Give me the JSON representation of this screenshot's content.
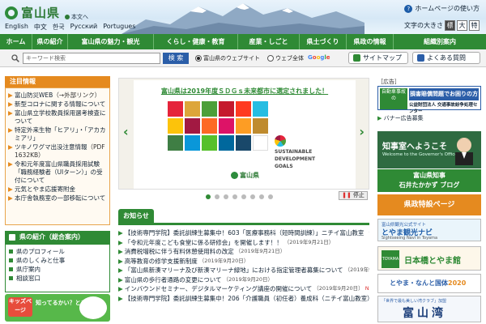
{
  "header": {
    "logo_text": "富山県",
    "skip_link": "本文へ",
    "languages": [
      "English",
      "中文",
      "한국",
      "Русский",
      "Portugues"
    ],
    "howto_link": "ホームページの使い方",
    "fontsize_label": "文字の大きさ",
    "fontsize_options": [
      "標",
      "大",
      "特"
    ]
  },
  "nav": {
    "items": [
      "ホーム",
      "県の紹介",
      "富山県の魅力・観光",
      "くらし・健康・教育",
      "産業・しごと",
      "県土づくり",
      "県政の情報",
      "組織別案内"
    ]
  },
  "search": {
    "placeholder": "キーワード検索",
    "button_label": "検 索",
    "options": [
      "富山県のウェブサイト",
      "ウェブ全体"
    ],
    "google_label": "Google",
    "sitemap_label": "サイトマップ",
    "faq_label": "よくある質問"
  },
  "notices": {
    "heading": "注目情報",
    "items": [
      {
        "text": "富山防災WEB",
        "tag": "（→外部リンク）"
      },
      {
        "text": "新型コロナに関する情報について",
        "tag": ""
      },
      {
        "text": "富山県立学校教員採用選考検査について",
        "tag": ""
      },
      {
        "text": "特定外来生物「ヒアリ」・「アカカミアリ」",
        "tag": ""
      },
      {
        "text": "ツキノワグマ出没注意情報",
        "tag": "（PDF 1632KB）"
      },
      {
        "text": "令和元年度富山県職員採用試験「職務経験者（UIターン）」の受付について",
        "tag": ""
      },
      {
        "text": "元気とやま応援寄附金",
        "tag": ""
      },
      {
        "text": "本庁舎執務室の一部移転について",
        "tag": ""
      }
    ]
  },
  "pref_info": {
    "heading": "県の紹介（総合案内）",
    "items": [
      "県のプロフィール",
      "県のしくみと仕事",
      "県庁案内",
      "相談窓口"
    ]
  },
  "kids": {
    "badge": "キッズページ",
    "text": "知ってるかい？とやまけん"
  },
  "slider": {
    "headline": "富山県は2019年度ＳＤＧｓ未来都市に選定されました！",
    "sdg_colors": [
      "#e5243b",
      "#dda63a",
      "#4c9f38",
      "#c5192d",
      "#ff3a21",
      "#26bde2",
      "#fcc30b",
      "#a21942",
      "#fd6925",
      "#dd1367",
      "#fd9d24",
      "#bf8b2e",
      "#3f7e44",
      "#0a97d9",
      "#56c02b",
      "#00689d",
      "#19486a",
      "#ffffff"
    ],
    "goals_text": "SUSTAINABLE DEVELOPMENT GOALS",
    "logo_text": "富山県",
    "stop_label": "停止",
    "dot_count": 8,
    "active_dot": 0
  },
  "news": {
    "heading": "お知らせ",
    "items": [
      {
        "text": "【技術専門学院】委託訓練生募集中！603「医療事務科（短時間訓練）」ニチイ富山教室",
        "date": "（2019年9月22日）",
        "new": false
      },
      {
        "text": "「令和元年度こども食堂に係る研修会」を開催します！！",
        "date": "（2019年9月21日）",
        "new": false
      },
      {
        "text": "消費税増税に伴う有料休憩使用料の改定",
        "date": "（2019年9月21日）",
        "new": false
      },
      {
        "text": "高等教育の修学支援新制度",
        "date": "（2019年9月20日）",
        "new": false
      },
      {
        "text": "「富山県新湊マリーナ及び新湊マリーナ緑地」における指定管理者募集について",
        "date": "（2019年9月20日）",
        "new": false
      },
      {
        "text": "富山県の歩行者通路の変更について",
        "date": "（2019年9月20日）",
        "new": false
      },
      {
        "text": "インバウンドセミナー、デジタルマーケティング講座の開催について",
        "date": "（2019年9月20日）",
        "new": true
      },
      {
        "text": "【技術専門学院】委託訓練生募集中！206「介護職員（初任者）養成科（ニチイ富山教室）」",
        "date": "",
        "new": false
      }
    ]
  },
  "right": {
    "ad_label": "［広告］",
    "ad_car": "自動車事故の",
    "ad_title": "損害賠償問題でお困りの方へ",
    "ad_sub": "公益財団法人 交通事故紛争処理センター",
    "ad_link": "バナー広告募集",
    "gov_title": "知事室へようこそ",
    "gov_sub": "Welcome to the Governor's Office",
    "blog_line1": "富山県知事",
    "blog_line2": "石井たかかず ブログ",
    "feature": "県政特設ページ",
    "navi_top": "富山県観光公式サイト",
    "navi_main": "とやま観光ナビ",
    "navi_sub": "Sightseeing Navi in Toyama",
    "hm_box": "TOYAMA",
    "hm_text": "日本橋とやま館",
    "kokutai_text": "とやま・なんと国体",
    "kokutai_year": "2020",
    "wan_sub": "「世界で最も美しい湾クラブ」加盟",
    "wan_main": "富山湾"
  }
}
